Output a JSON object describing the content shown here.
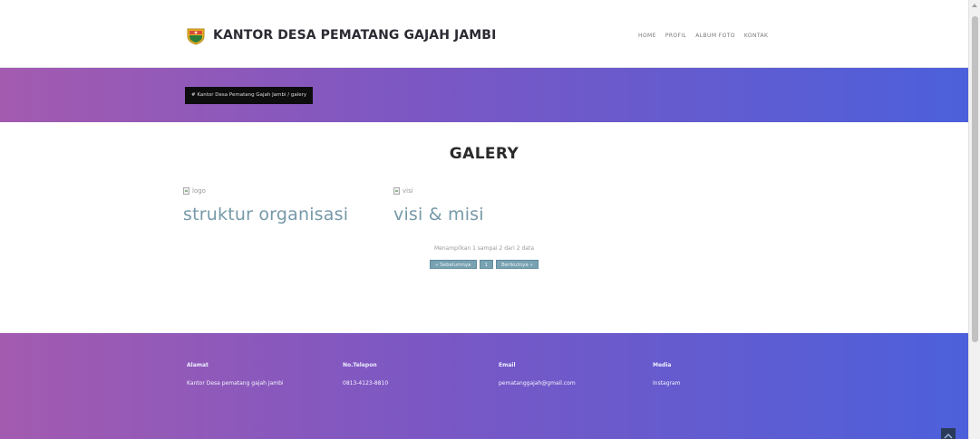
{
  "header": {
    "title": "KANTOR DESA PEMATANG GAJAH JAMBI",
    "nav": [
      "HOME",
      "PROFIL",
      "ALBUM FOTO",
      "KONTAK"
    ]
  },
  "banner": {
    "breadcrumb": "# Kantor Desa Pematang Gajah Jambi / galery"
  },
  "main": {
    "title": "GALERY",
    "cards": [
      {
        "img_alt": "logo",
        "caption": "struktur organisasi"
      },
      {
        "img_alt": "visi",
        "caption": "visi & misi"
      }
    ],
    "pager": {
      "info": "Menampilkan 1 sampai 2 dari 2 data",
      "buttons": [
        "« Sebelumnya",
        "1",
        "Berikutnya »"
      ]
    }
  },
  "footer": {
    "columns": [
      {
        "label": "Alamat",
        "value": "Kantor Desa pematang gajah Jambi"
      },
      {
        "label": "No.Telepon",
        "value": "0813-4123-8810"
      },
      {
        "label": "Email",
        "value": "pematanggajah@gmail.com"
      },
      {
        "label": "Media",
        "value": "Instagram"
      }
    ]
  },
  "colors": {
    "gradient_start": "#a35bb0",
    "gradient_mid": "#7a57c4",
    "gradient_end": "#4c60db",
    "caption": "#7699a8",
    "pager_button": "#78a2b2"
  },
  "icons": {
    "logo": "emblem-icon",
    "broken_image": "broken-image-icon",
    "back_to_top": "chevron-up-icon"
  }
}
